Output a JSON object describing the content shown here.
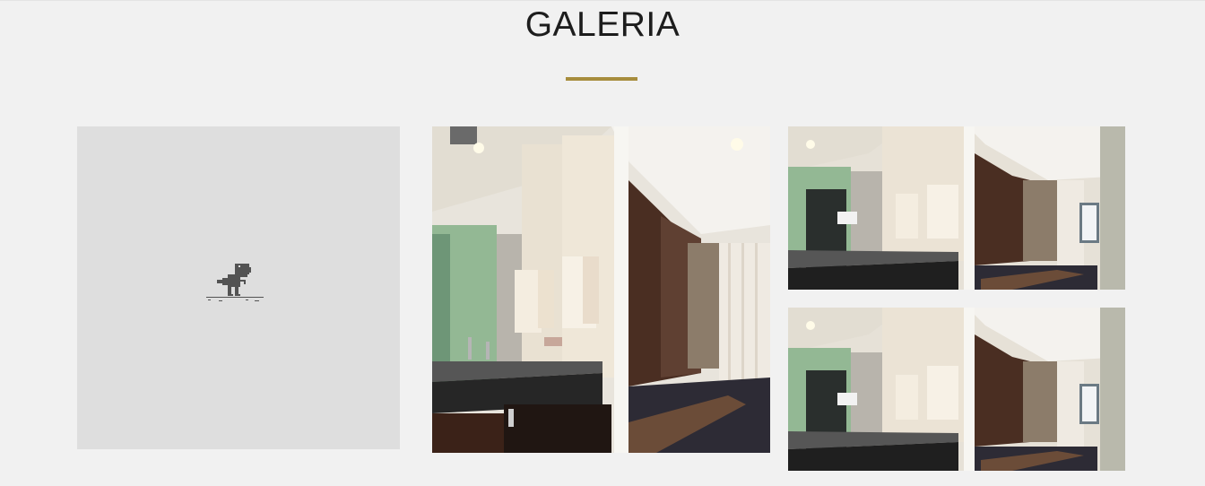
{
  "section": {
    "title": "GALERIA"
  },
  "colors": {
    "background": "#f1f1f1",
    "divider": "#a78d3d",
    "placeholder": "#dedede"
  },
  "gallery": {
    "items": [
      {
        "kind": "broken-image",
        "icon": "offline-dino-icon"
      },
      {
        "kind": "photo",
        "subject": "bathroom-vanity-photo"
      },
      {
        "kind": "photo",
        "subject": "bathroom-vanity-photo"
      },
      {
        "kind": "photo",
        "subject": "bathroom-vanity-photo"
      }
    ]
  }
}
